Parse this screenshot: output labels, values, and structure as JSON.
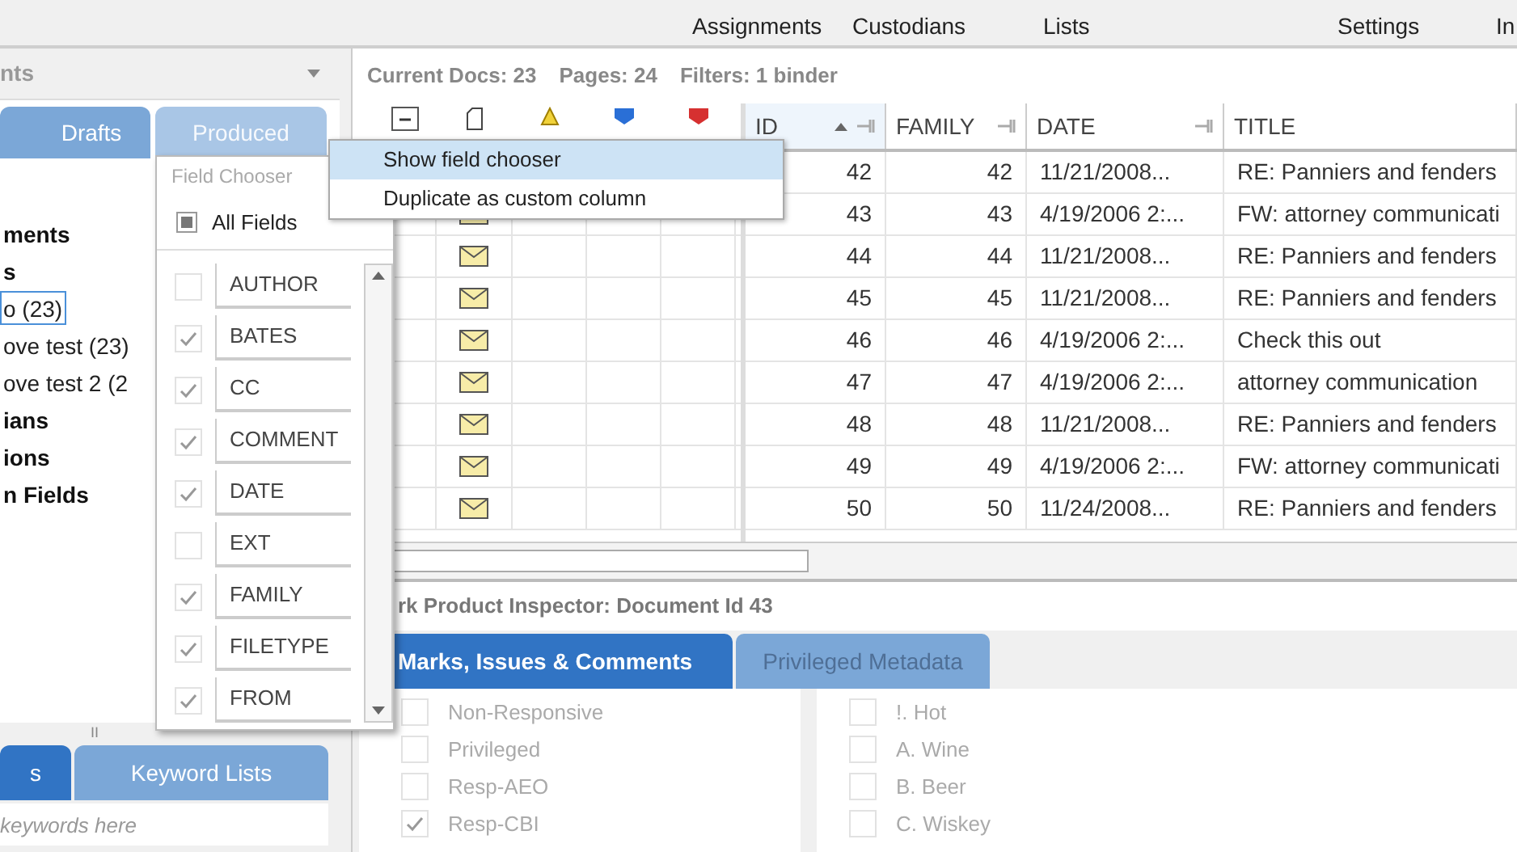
{
  "top_menu": [
    {
      "label": "Assignments"
    },
    {
      "label": "Custodians"
    },
    {
      "label": "Lists"
    },
    {
      "label": "Settings"
    },
    {
      "label": "In"
    }
  ],
  "left_panel": {
    "header": "nts",
    "tabs": [
      {
        "label": "Drafts",
        "selected": true
      },
      {
        "label": "Produced",
        "selected": false
      }
    ],
    "tree": [
      {
        "label": "ments",
        "kind": "group",
        "selected": false
      },
      {
        "label": "s",
        "kind": "group",
        "selected": false
      },
      {
        "label": "o (23)",
        "kind": "item",
        "selected": true
      },
      {
        "label": "ove test (23)",
        "kind": "item",
        "selected": false
      },
      {
        "label": "ove test 2 (2",
        "kind": "item",
        "selected": false
      },
      {
        "label": "ians",
        "kind": "group",
        "selected": false
      },
      {
        "label": "ions",
        "kind": "group",
        "selected": false
      },
      {
        "label": "n Fields",
        "kind": "group",
        "selected": false
      }
    ],
    "splitter": "II",
    "bottom_tabs": [
      {
        "label": "s",
        "selected": true
      },
      {
        "label": "Keyword Lists",
        "selected": false
      }
    ],
    "search": {
      "placeholder": "keywords here"
    }
  },
  "summary": [
    {
      "text": "Current Docs: 23"
    },
    {
      "text": "Pages: 24"
    },
    {
      "text": "Filters: 1 binder"
    }
  ],
  "table": {
    "columns": [
      {
        "label": "ID",
        "sorted": true,
        "pin": true
      },
      {
        "label": "FAMILY",
        "sorted": false,
        "pin": true
      },
      {
        "label": "DATE",
        "sorted": false,
        "pin": true
      },
      {
        "label": "TITLE",
        "sorted": false,
        "pin": false
      }
    ],
    "rows": [
      {
        "cells": [
          "42",
          "42",
          "11/21/2008...",
          "RE: Panniers and fenders"
        ]
      },
      {
        "cells": [
          "43",
          "43",
          "4/19/2006 2:...",
          "FW: attorney communicati"
        ]
      },
      {
        "cells": [
          "44",
          "44",
          "11/21/2008...",
          "RE: Panniers and fenders"
        ]
      },
      {
        "cells": [
          "45",
          "45",
          "11/21/2008...",
          "RE: Panniers and fenders"
        ]
      },
      {
        "cells": [
          "46",
          "46",
          "4/19/2006 2:...",
          "Check this out"
        ]
      },
      {
        "cells": [
          "47",
          "47",
          "4/19/2006 2:...",
          "attorney communication"
        ]
      },
      {
        "cells": [
          "48",
          "48",
          "11/21/2008...",
          "RE: Panniers and fenders"
        ]
      },
      {
        "cells": [
          "49",
          "49",
          "4/19/2006 2:...",
          "FW: attorney communicati"
        ]
      },
      {
        "cells": [
          "50",
          "50",
          "11/24/2008...",
          "RE: Panniers and fenders"
        ]
      }
    ]
  },
  "inspector": {
    "title": "rk Product Inspector: Document Id 43",
    "tabs": [
      {
        "label": "Marks, Issues & Comments",
        "selected": true
      },
      {
        "label": "Privileged Metadata",
        "selected": false
      }
    ],
    "marks": [
      {
        "label": "Non-Responsive",
        "checked": false
      },
      {
        "label": "Privileged",
        "checked": false
      },
      {
        "label": "Resp-AEO",
        "checked": false
      },
      {
        "label": "Resp-CBI",
        "checked": true
      }
    ],
    "issues": [
      {
        "label": "!. Hot",
        "checked": false
      },
      {
        "label": "A. Wine",
        "checked": false
      },
      {
        "label": "B. Beer",
        "checked": false
      },
      {
        "label": "C. Wiskey",
        "checked": false
      }
    ]
  },
  "context_menu": [
    {
      "label": "Show field chooser",
      "selected": true
    },
    {
      "label": "Duplicate as custom column",
      "selected": false
    }
  ],
  "field_chooser": {
    "title": "Field Chooser",
    "all_fields": {
      "label": "All Fields",
      "indeterminate": true
    },
    "fields": [
      {
        "label": "AUTHOR",
        "checked": false
      },
      {
        "label": "BATES",
        "checked": true
      },
      {
        "label": "CC",
        "checked": true
      },
      {
        "label": "COMMENT",
        "checked": true
      },
      {
        "label": "DATE",
        "checked": true
      },
      {
        "label": "EXT",
        "checked": false
      },
      {
        "label": "FAMILY",
        "checked": true
      },
      {
        "label": "FILETYPE",
        "checked": true
      },
      {
        "label": "FROM",
        "checked": true
      }
    ]
  }
}
